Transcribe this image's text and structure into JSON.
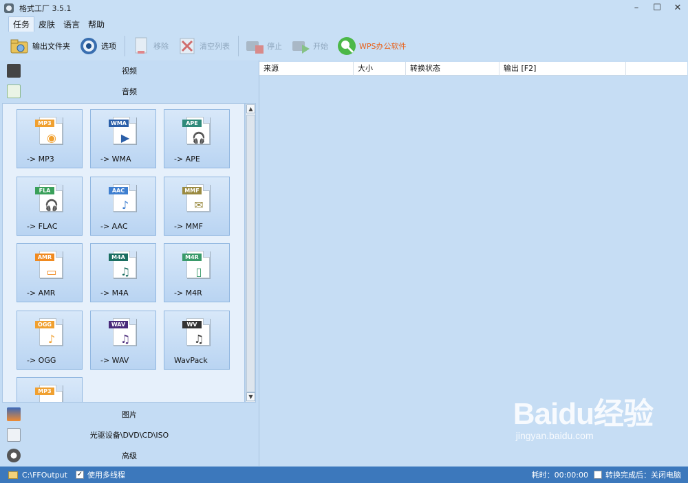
{
  "window": {
    "title": "格式工厂 3.5.1",
    "minimize": "–",
    "maximize": "☐",
    "close": "✕"
  },
  "menu": [
    "任务",
    "皮肤",
    "语言",
    "帮助"
  ],
  "toolbar": {
    "output_folder": "输出文件夹",
    "options": "选项",
    "remove": "移除",
    "clear_list": "清空列表",
    "stop": "停止",
    "start": "开始",
    "wps": "WPS办公软件"
  },
  "categories": {
    "video": "视频",
    "audio": "音频",
    "picture": "图片",
    "rom": "光驱设备\\DVD\\CD\\ISO",
    "advanced": "高级"
  },
  "audio_formats": [
    {
      "badge": "MP3",
      "label": "-> MP3",
      "badge_color": "#f0a030",
      "glyph": "◉"
    },
    {
      "badge": "WMA",
      "label": "-> WMA",
      "badge_color": "#2b5fa8",
      "glyph": "▶"
    },
    {
      "badge": "APE",
      "label": "-> APE",
      "badge_color": "#2f8a7a",
      "glyph": "🎧"
    },
    {
      "badge": "FLA",
      "label": "-> FLAC",
      "badge_color": "#3aa05a",
      "glyph": "🎧"
    },
    {
      "badge": "AAC",
      "label": "-> AAC",
      "badge_color": "#3f7fd0",
      "glyph": "♪"
    },
    {
      "badge": "MMF",
      "label": "-> MMF",
      "badge_color": "#9a8a40",
      "glyph": "✉"
    },
    {
      "badge": "AMR",
      "label": "-> AMR",
      "badge_color": "#f08a20",
      "glyph": "▭"
    },
    {
      "badge": "M4A",
      "label": "-> M4A",
      "badge_color": "#1a6e60",
      "glyph": "♫"
    },
    {
      "badge": "M4R",
      "label": "-> M4R",
      "badge_color": "#3a9a6a",
      "glyph": "▯"
    },
    {
      "badge": "OGG",
      "label": "-> OGG",
      "badge_color": "#f0a030",
      "glyph": "♪"
    },
    {
      "badge": "WAV",
      "label": "-> WAV",
      "badge_color": "#4a2a7a",
      "glyph": "♫"
    },
    {
      "badge": "WV",
      "label": "WavPack",
      "badge_color": "#333333",
      "glyph": "♫"
    },
    {
      "badge": "MP3",
      "label": "",
      "badge_color": "#f0a030",
      "glyph": ""
    }
  ],
  "grid": {
    "columns": [
      "来源",
      "大小",
      "转换状态",
      "输出 [F2]"
    ]
  },
  "watermark": {
    "brand": "Baidu经验",
    "site": "jingyan.baidu.com"
  },
  "status": {
    "output_path": "C:\\FFOutput",
    "multithread_label": "使用多线程",
    "elapsed": "耗时：00:00:00",
    "after_done": "转换完成后：关闭电脑"
  }
}
